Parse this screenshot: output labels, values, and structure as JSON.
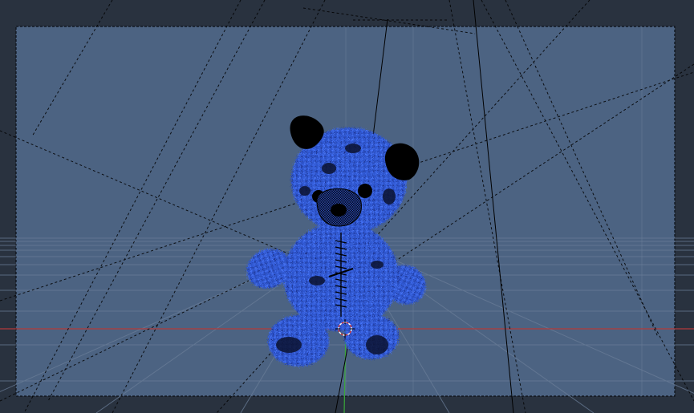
{
  "viewport": {
    "mode": "camera-view",
    "background_color": "#29323f",
    "camera_frame_fill": "#4c6382",
    "camera_frame_border": "#000000",
    "grid_color": "#5a6d87",
    "x_axis_color": "#b33a3a",
    "y_axis_color": "#3aa63a",
    "wire_color": "#000000",
    "model": {
      "name": "teddy-bear",
      "fill_color": "#2f57cf",
      "highlight_color": "#4a78ff",
      "shadow_color": "#102050",
      "ear_color": "#000000"
    },
    "cursor_icon": "3d-cursor-icon"
  }
}
